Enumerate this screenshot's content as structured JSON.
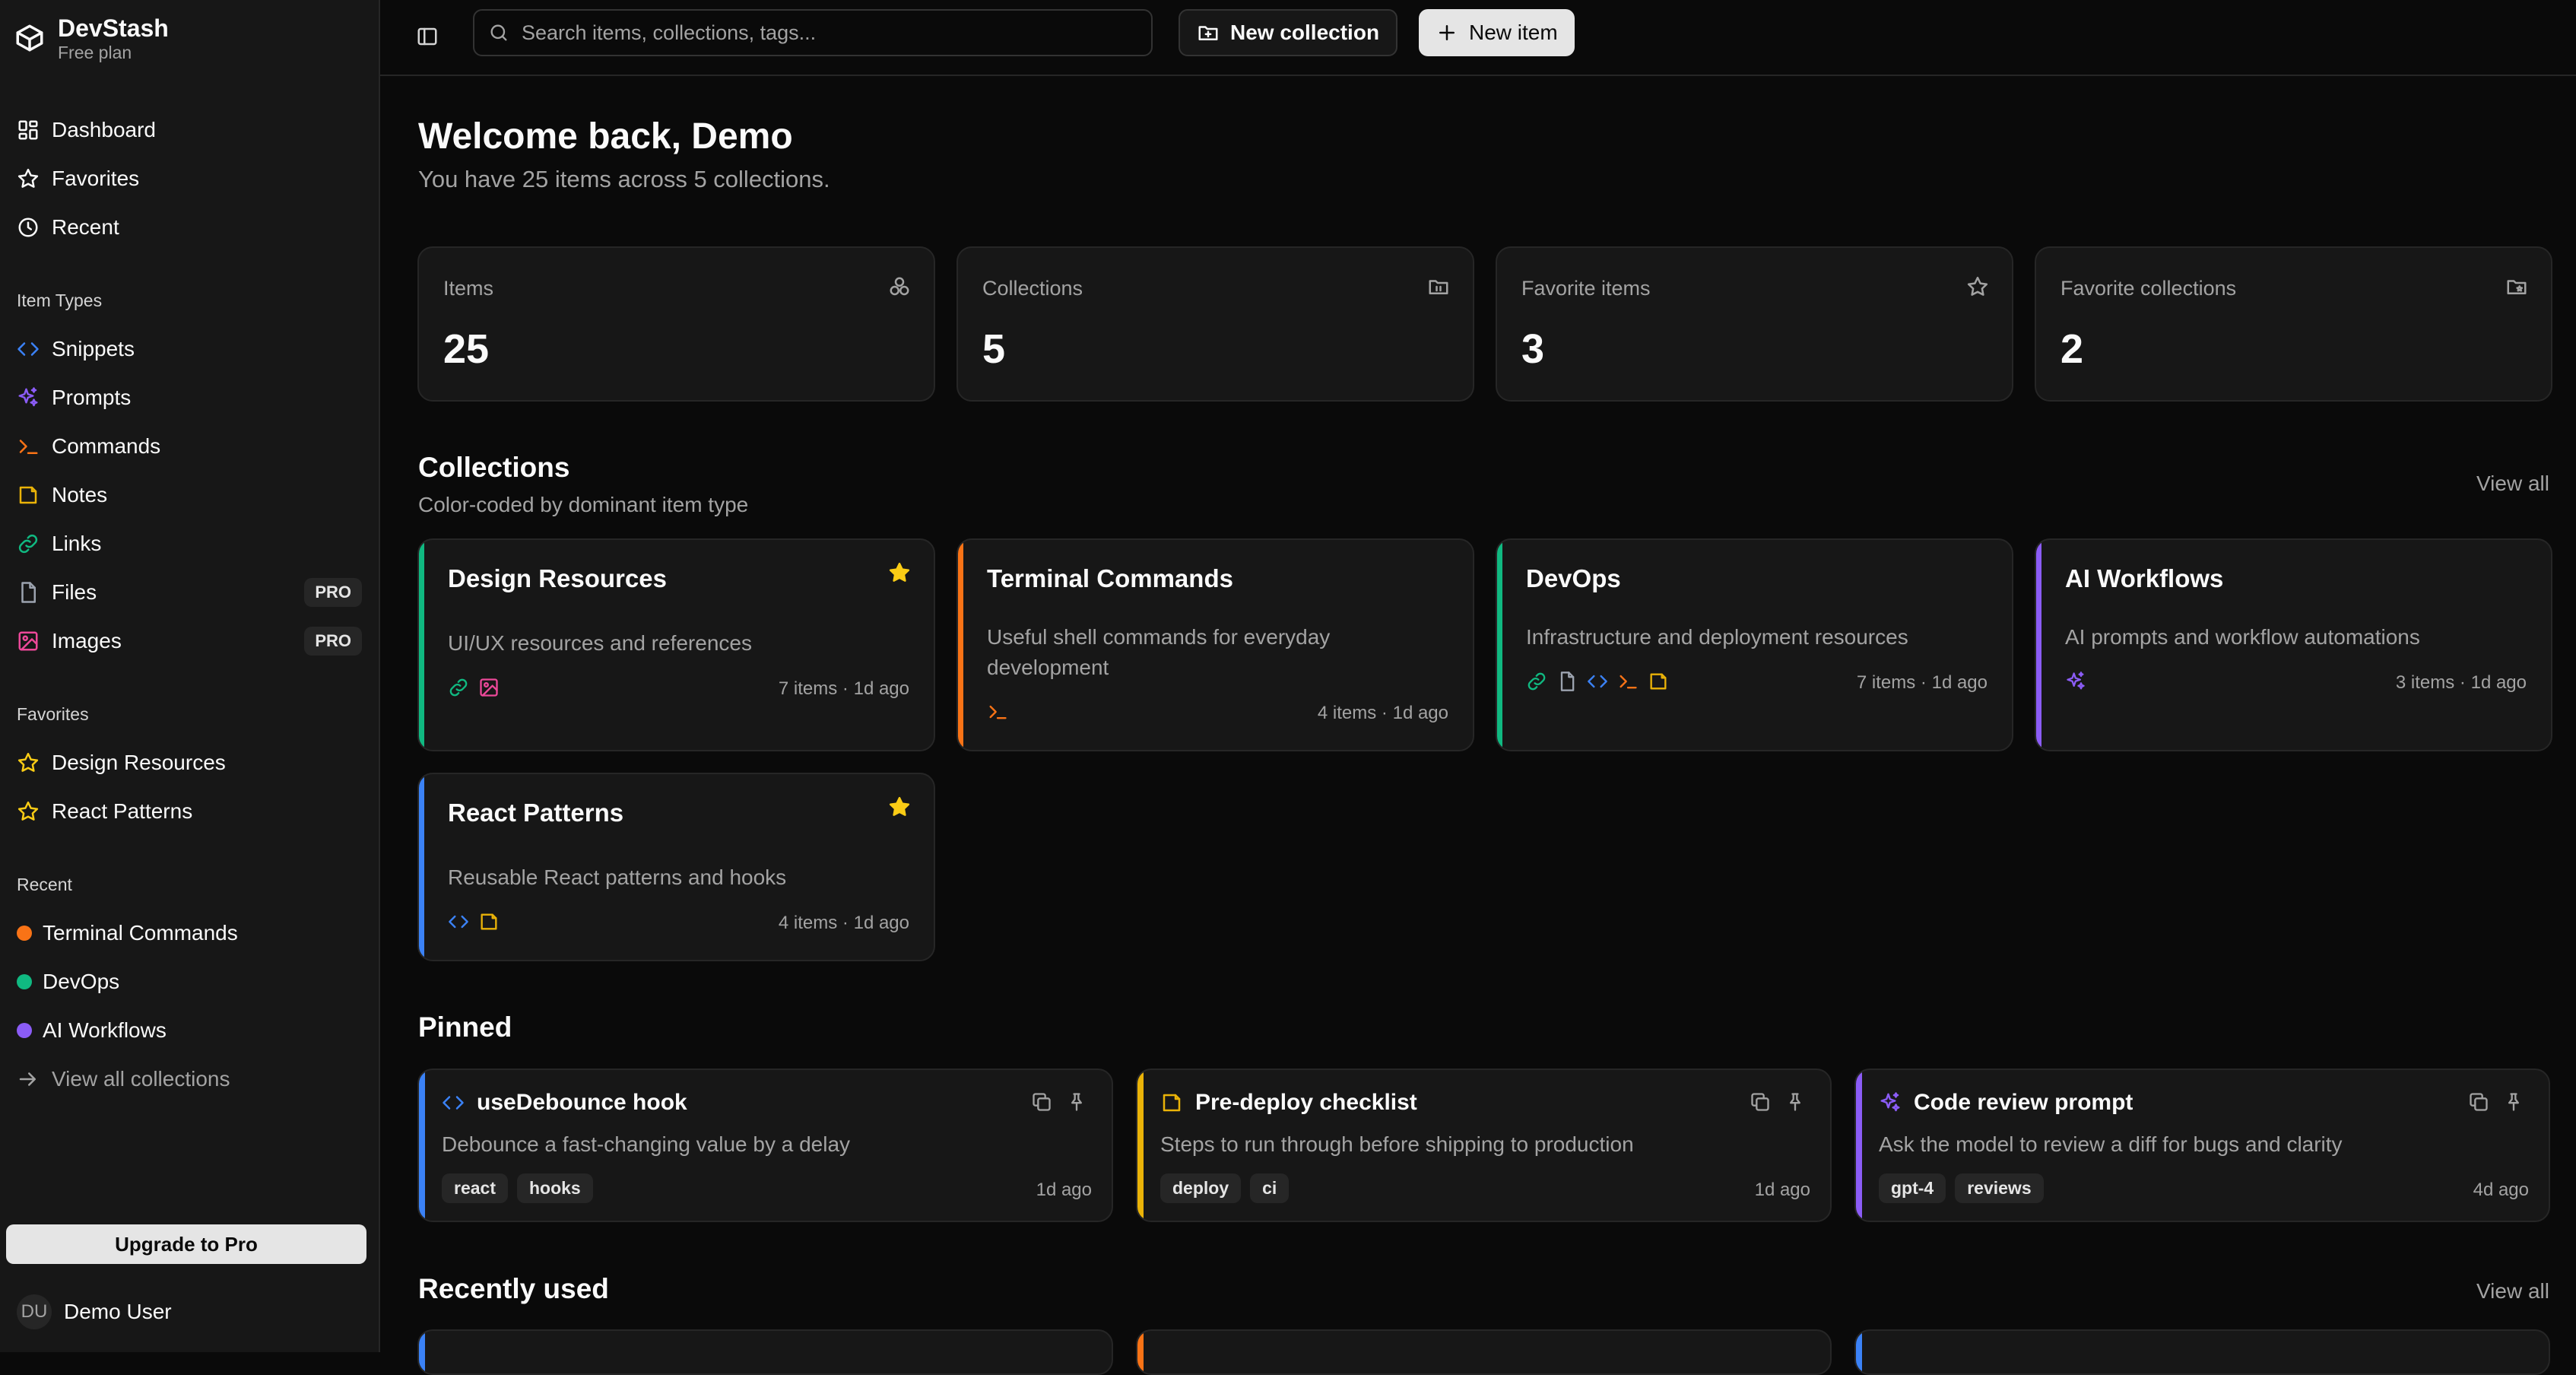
{
  "app": {
    "name": "DevStash",
    "plan": "Free plan"
  },
  "colors": {
    "snippets": "#3b82f6",
    "prompts": "#8b5cf6",
    "commands": "#f97316",
    "notes": "#eab308",
    "links": "#10b981",
    "files": "#9ca3af",
    "images": "#ec4899",
    "favorite_star": "#facc15"
  },
  "sidebar": {
    "nav": [
      {
        "label": "Dashboard",
        "icon": "dashboard-icon"
      },
      {
        "label": "Favorites",
        "icon": "star-icon"
      },
      {
        "label": "Recent",
        "icon": "clock-icon"
      }
    ],
    "item_types_label": "Item Types",
    "item_types": [
      {
        "label": "Snippets",
        "icon": "code-icon"
      },
      {
        "label": "Prompts",
        "icon": "sparkles-icon"
      },
      {
        "label": "Commands",
        "icon": "terminal-icon"
      },
      {
        "label": "Notes",
        "icon": "note-icon"
      },
      {
        "label": "Links",
        "icon": "link-icon"
      },
      {
        "label": "Files",
        "icon": "file-icon",
        "badge": "PRO"
      },
      {
        "label": "Images",
        "icon": "image-icon",
        "badge": "PRO"
      }
    ],
    "favorites_label": "Favorites",
    "favorites": [
      {
        "label": "Design Resources"
      },
      {
        "label": "React Patterns"
      }
    ],
    "recent_label": "Recent",
    "recent": [
      {
        "label": "Terminal Commands",
        "color": "#f97316"
      },
      {
        "label": "DevOps",
        "color": "#10b981"
      },
      {
        "label": "AI Workflows",
        "color": "#8b5cf6"
      }
    ],
    "view_all_collections": "View all collections",
    "upgrade_label": "Upgrade to Pro",
    "user": {
      "initials": "DU",
      "name": "Demo User"
    }
  },
  "topbar": {
    "search_placeholder": "Search items, collections, tags...",
    "new_collection": "New collection",
    "new_item": "New item"
  },
  "welcome": {
    "title": "Welcome back, Demo",
    "subtitle": "You have 25 items across 5 collections."
  },
  "stats": [
    {
      "label": "Items",
      "value": "25",
      "icon": "items-icon"
    },
    {
      "label": "Collections",
      "value": "5",
      "icon": "folder-icon"
    },
    {
      "label": "Favorite items",
      "value": "3",
      "icon": "star-icon"
    },
    {
      "label": "Favorite collections",
      "value": "2",
      "icon": "folder-star-icon"
    }
  ],
  "collections": {
    "title": "Collections",
    "subtitle": "Color-coded by dominant item type",
    "view_all": "View all",
    "cards": [
      {
        "title": "Design Resources",
        "description": "UI/UX resources and references",
        "meta": "7 items · 1d ago",
        "favorite": true,
        "accent": "#10b981",
        "icons": [
          "link-icon",
          "image-icon"
        ]
      },
      {
        "title": "Terminal Commands",
        "description": "Useful shell commands for everyday development",
        "meta": "4 items · 1d ago",
        "favorite": false,
        "accent": "#f97316",
        "icons": [
          "terminal-icon"
        ]
      },
      {
        "title": "DevOps",
        "description": "Infrastructure and deployment resources",
        "meta": "7 items · 1d ago",
        "favorite": false,
        "accent": "#10b981",
        "icons": [
          "link-icon",
          "file-icon",
          "code-icon",
          "terminal-icon",
          "note-icon"
        ]
      },
      {
        "title": "AI Workflows",
        "description": "AI prompts and workflow automations",
        "meta": "3 items · 1d ago",
        "favorite": false,
        "accent": "#8b5cf6",
        "icons": [
          "sparkles-icon"
        ]
      },
      {
        "title": "React Patterns",
        "description": "Reusable React patterns and hooks",
        "meta": "4 items · 1d ago",
        "favorite": true,
        "accent": "#3b82f6",
        "icons": [
          "code-icon",
          "note-icon"
        ]
      }
    ]
  },
  "pinned": {
    "title": "Pinned",
    "items": [
      {
        "title": "useDebounce hook",
        "description": "Debounce a fast-changing value by a delay",
        "tags": [
          "react",
          "hooks"
        ],
        "age": "1d ago",
        "type_icon": "code-icon",
        "accent": "#3b82f6"
      },
      {
        "title": "Pre-deploy checklist",
        "description": "Steps to run through before shipping to production",
        "tags": [
          "deploy",
          "ci"
        ],
        "age": "1d ago",
        "type_icon": "note-icon",
        "accent": "#eab308"
      },
      {
        "title": "Code review prompt",
        "description": "Ask the model to review a diff for bugs and clarity",
        "tags": [
          "gpt-4",
          "reviews"
        ],
        "age": "4d ago",
        "type_icon": "sparkles-icon",
        "accent": "#8b5cf6"
      }
    ]
  },
  "recently_used": {
    "title": "Recently used",
    "view_all": "View all",
    "accents": [
      "#3b82f6",
      "#f97316",
      "#3b82f6"
    ]
  }
}
